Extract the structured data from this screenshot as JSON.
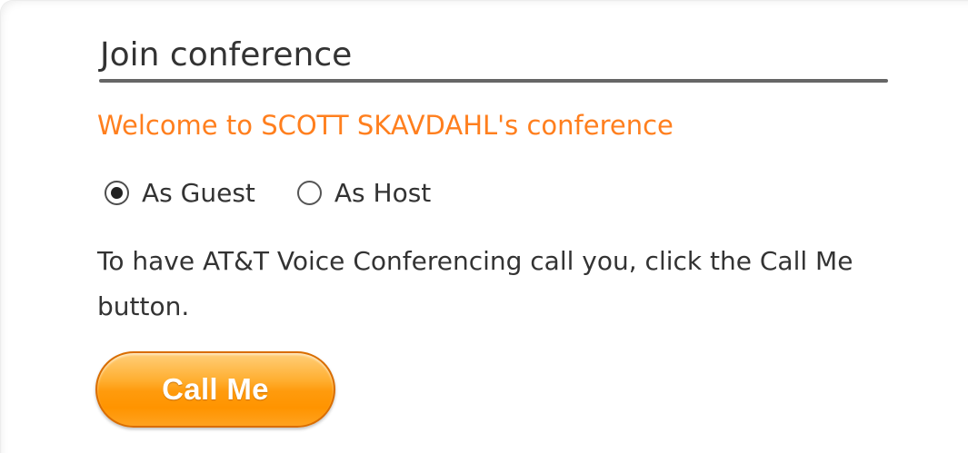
{
  "header": {
    "title": "Join conference"
  },
  "welcome_text": "Welcome to SCOTT SKAVDAHL's conference",
  "role_selector": {
    "options": [
      {
        "label": "As Guest",
        "selected": true
      },
      {
        "label": "As Host",
        "selected": false
      }
    ]
  },
  "instructions": "To have AT&T Voice Conferencing call you, click the Call Me button.",
  "call_button": {
    "label": "Call Me"
  },
  "colors": {
    "accent": "#ff7f1e",
    "button_orange": "#ff9400",
    "text": "#333333",
    "rule": "#666666"
  }
}
